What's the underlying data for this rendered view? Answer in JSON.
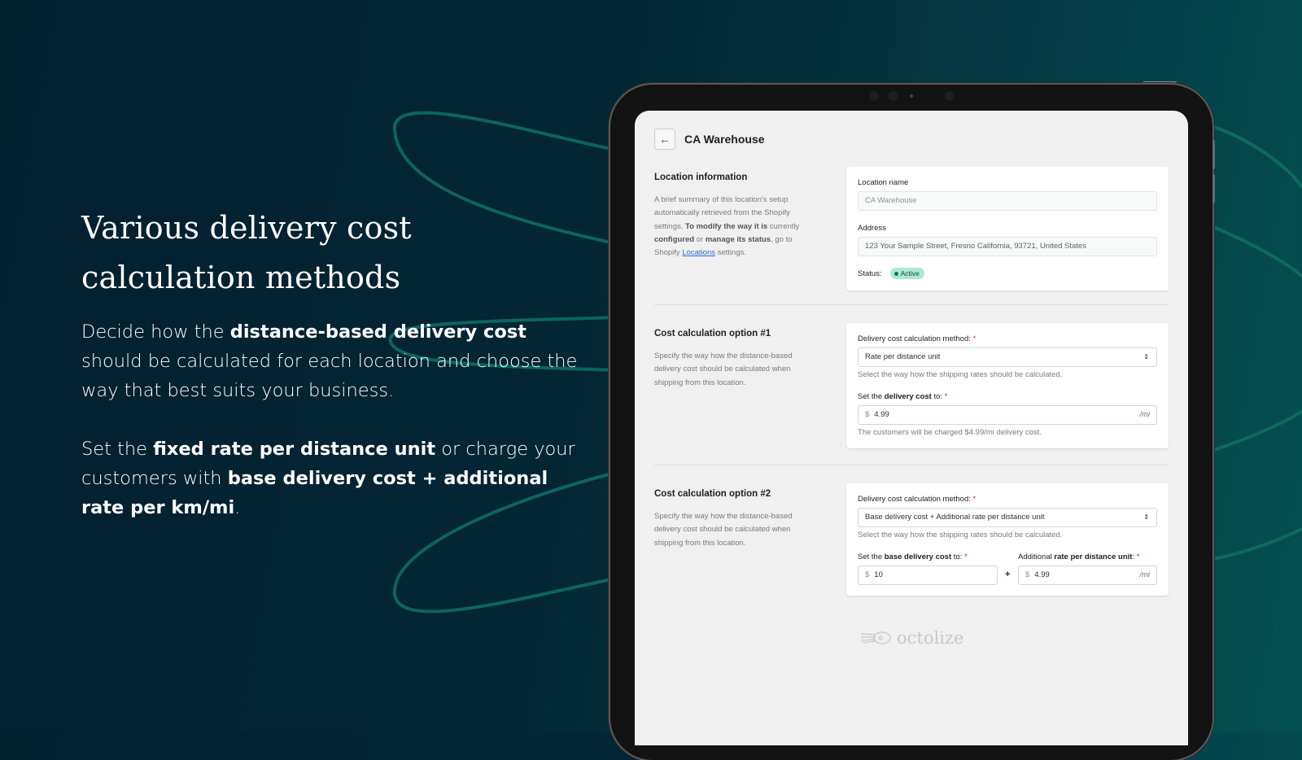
{
  "hero": {
    "title": "Various delivery cost calculation methods",
    "p1": {
      "pre": "Decide how the ",
      "bold": "distance-based delivery cost",
      "post": " should be calculated for each location and choose the way that best suits your business."
    },
    "p2": {
      "pre": "Set the ",
      "bold1": "fixed rate per distance unit",
      "mid": " or charge your customers with ",
      "bold2": "base delivery cost + additional rate per km/mi",
      "post": "."
    }
  },
  "app": {
    "back_icon": "←",
    "page_title": "CA Warehouse",
    "location_info": {
      "title": "Location information",
      "desc_1": "A brief summary of this location's setup automatically retrieved from the Shopify settings. ",
      "desc_b1": "To modify the way it is",
      "desc_2": " currently ",
      "desc_b2": "configured",
      "desc_3": " or ",
      "desc_b3": "manage its status",
      "desc_4": ", go to Shopify ",
      "desc_link": "Locations",
      "desc_5": " settings.",
      "name_label": "Location name",
      "name_value": "CA Warehouse",
      "address_label": "Address",
      "address_value": "123 Your Sample Street, Fresno California, 93721, United States",
      "status_label": "Status:",
      "status_value": "Active"
    },
    "option1": {
      "title": "Cost calculation option #1",
      "desc": "Specify the way how the distance-based delivery cost should be calculated when shipping from this location.",
      "method_label": "Delivery cost calculation method:",
      "method_value": "Rate per distance unit",
      "method_help": "Select the way how the shipping rates should be calculated.",
      "cost_label_pre": "Set the ",
      "cost_label_bold": "delivery cost",
      "cost_label_post": " to:",
      "currency": "$",
      "cost_value": "4.99",
      "unit_suffix": "/mi",
      "cost_help": "The customers will be charged $4.99/mi delivery cost."
    },
    "option2": {
      "title": "Cost calculation option #2",
      "desc": "Specify the way how the distance-based delivery cost should be calculated when shipping from this location.",
      "method_label": "Delivery cost calculation method:",
      "method_value": "Base delivery cost + Additional rate per distance unit",
      "method_help": "Select the way how the shipping rates should be calculated.",
      "base_label_pre": "Set the ",
      "base_label_bold": "base delivery cost",
      "base_label_post": " to:",
      "rate_label_pre": "Additional ",
      "rate_label_bold": "rate per distance unit",
      "rate_label_post": ":",
      "currency": "$",
      "base_value": "10",
      "plus": "+",
      "rate_value": "4.99",
      "unit_suffix": "/mi"
    },
    "required_mark": "*",
    "select_arrows": "⇕",
    "brand": "octolize"
  }
}
